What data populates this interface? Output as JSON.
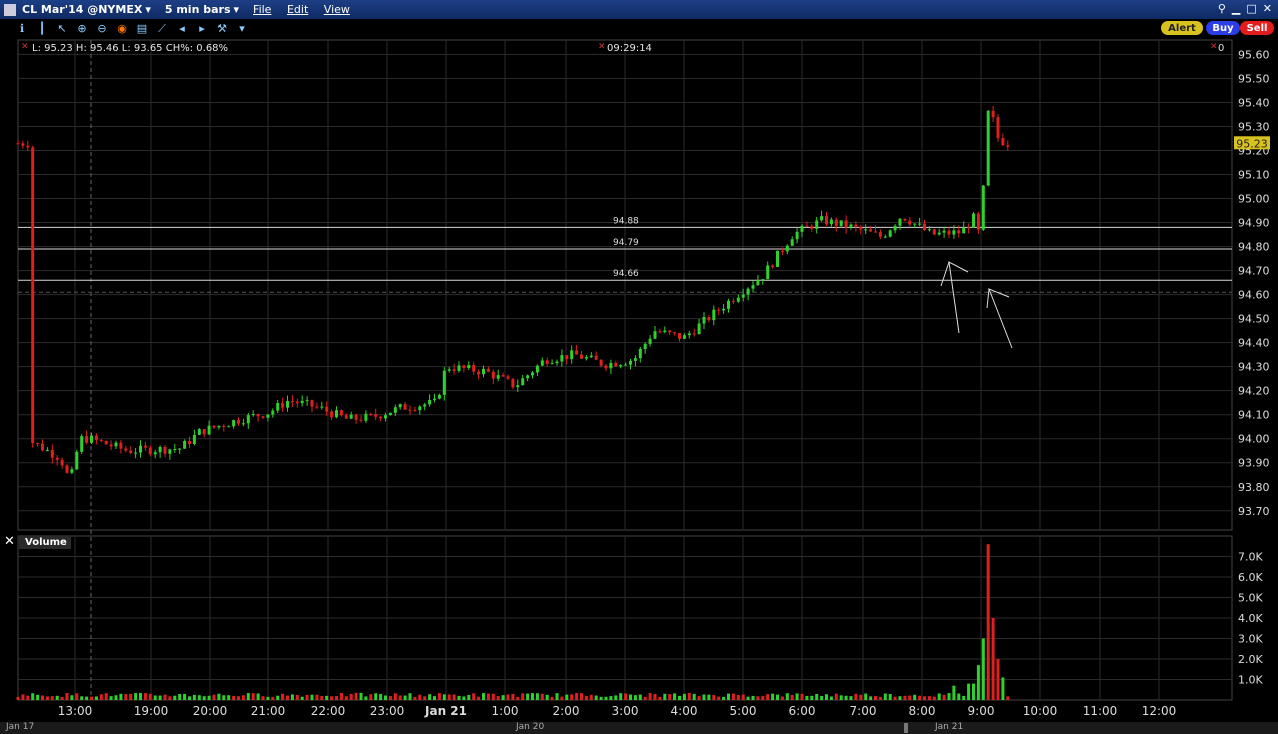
{
  "title_bar": {
    "symbol": "CL Mar'14 @NYMEX",
    "bar_size": "5 min bars",
    "menu": [
      "File",
      "Edit",
      "View"
    ]
  },
  "order_buttons": {
    "alert": "Alert",
    "buy": "Buy",
    "sell": "Sell"
  },
  "info": {
    "ohlc": "L: 95.23 H: 95.46 L: 93.65 CH%: 0.68%",
    "clock": "09:29:14",
    "zero_badge": "0"
  },
  "volume_panel_label": "Volume",
  "date_bar": [
    "Jan 17",
    "Jan 20",
    "Jan 21"
  ],
  "colors": {
    "up": "#2fd12f",
    "down": "#e01f1f",
    "grid": "#2b2b2b",
    "level_line": "#d8d8d8",
    "last_price_tag": "#d8c21f"
  },
  "chart_data": [
    {
      "type": "candlestick",
      "title": "",
      "ylim": [
        93.62,
        95.66
      ],
      "y_ticks": [
        95.6,
        95.5,
        95.4,
        95.3,
        95.2,
        95.1,
        95.0,
        94.9,
        94.8,
        94.7,
        94.6,
        94.5,
        94.4,
        94.3,
        94.2,
        94.1,
        94.0,
        93.9,
        93.8,
        93.7
      ],
      "x_tick_labels": [
        "13:00",
        "19:00",
        "20:00",
        "21:00",
        "22:00",
        "23:00",
        "Jan 21",
        "1:00",
        "2:00",
        "3:00",
        "4:00",
        "5:00",
        "6:00",
        "7:00",
        "8:00",
        "9:00",
        "10:00",
        "11:00",
        "12:00"
      ],
      "horizontal_levels": [
        {
          "label": "94.88",
          "value": 94.88
        },
        {
          "label": "94.79",
          "value": 94.79
        },
        {
          "label": "94.66",
          "value": 94.66
        }
      ],
      "last_price": 95.23,
      "last_price_label": "95.23",
      "price_path": [
        [
          "Jan 17 12:15",
          93.99
        ],
        [
          "Jan 17 12:45",
          93.92
        ],
        [
          "Jan 17 12:55",
          93.82
        ],
        [
          "Jan 17 13:10",
          94.0
        ],
        [
          "Jan 17 13:30",
          94.0
        ],
        [
          "Jan 17 18:45",
          93.95
        ],
        [
          "Jan 17 19:30",
          93.96
        ],
        [
          "Jan 17 19:50",
          94.03
        ],
        [
          "Jan 17 20:30",
          94.08
        ],
        [
          "Jan 17 21:00",
          94.11
        ],
        [
          "Jan 17 21:20",
          94.16
        ],
        [
          "Jan 17 21:50",
          94.13
        ],
        [
          "Jan 17 22:20",
          94.08
        ],
        [
          "Jan 17 22:45",
          94.09
        ],
        [
          "Jan 17 23:15",
          94.13
        ],
        [
          "Jan 17 23:50",
          94.15
        ],
        [
          "Jan 21 00:00",
          94.3
        ],
        [
          "Jan 21 00:40",
          94.28
        ],
        [
          "Jan 21 01:10",
          94.22
        ],
        [
          "Jan 21 01:40",
          94.33
        ],
        [
          "Jan 21 02:10",
          94.35
        ],
        [
          "Jan 21 02:40",
          94.31
        ],
        [
          "Jan 21 03:10",
          94.33
        ],
        [
          "Jan 21 03:30",
          94.45
        ],
        [
          "Jan 21 04:00",
          94.42
        ],
        [
          "Jan 21 04:30",
          94.52
        ],
        [
          "Jan 21 05:00",
          94.62
        ],
        [
          "Jan 21 05:20",
          94.68
        ],
        [
          "Jan 21 05:50",
          94.85
        ],
        [
          "Jan 21 06:20",
          94.91
        ],
        [
          "Jan 21 06:50",
          94.88
        ],
        [
          "Jan 21 07:20",
          94.84
        ],
        [
          "Jan 21 07:40",
          94.93
        ],
        [
          "Jan 21 08:10",
          94.85
        ],
        [
          "Jan 21 08:40",
          94.86
        ],
        [
          "Jan 21 08:55",
          94.93
        ],
        [
          "Jan 21 09:00",
          94.78
        ],
        [
          "Jan 21 09:05",
          95.33
        ],
        [
          "Jan 21 09:10",
          95.38
        ],
        [
          "Jan 21 09:15",
          95.26
        ],
        [
          "Jan 21 09:25",
          95.23
        ]
      ]
    },
    {
      "type": "bar",
      "title": "Volume",
      "ylim": [
        0,
        8000
      ],
      "y_ticks": [
        7000,
        6000,
        5000,
        4000,
        3000,
        2000,
        1000
      ],
      "y_tick_labels": [
        "7.0K",
        "6.0K",
        "5.0K",
        "4.0K",
        "3.0K",
        "2.0K",
        "1.0K"
      ],
      "notable_bars": [
        [
          "Jan 21 08:35",
          700
        ],
        [
          "Jan 21 08:50",
          800
        ],
        [
          "Jan 21 08:55",
          1700
        ],
        [
          "Jan 21 09:00",
          3000
        ],
        [
          "Jan 21 09:05",
          7600
        ],
        [
          "Jan 21 09:10",
          4000
        ],
        [
          "Jan 21 09:15",
          2000
        ],
        [
          "Jan 21 09:20",
          1100
        ]
      ],
      "baseline_volume": 150
    }
  ]
}
